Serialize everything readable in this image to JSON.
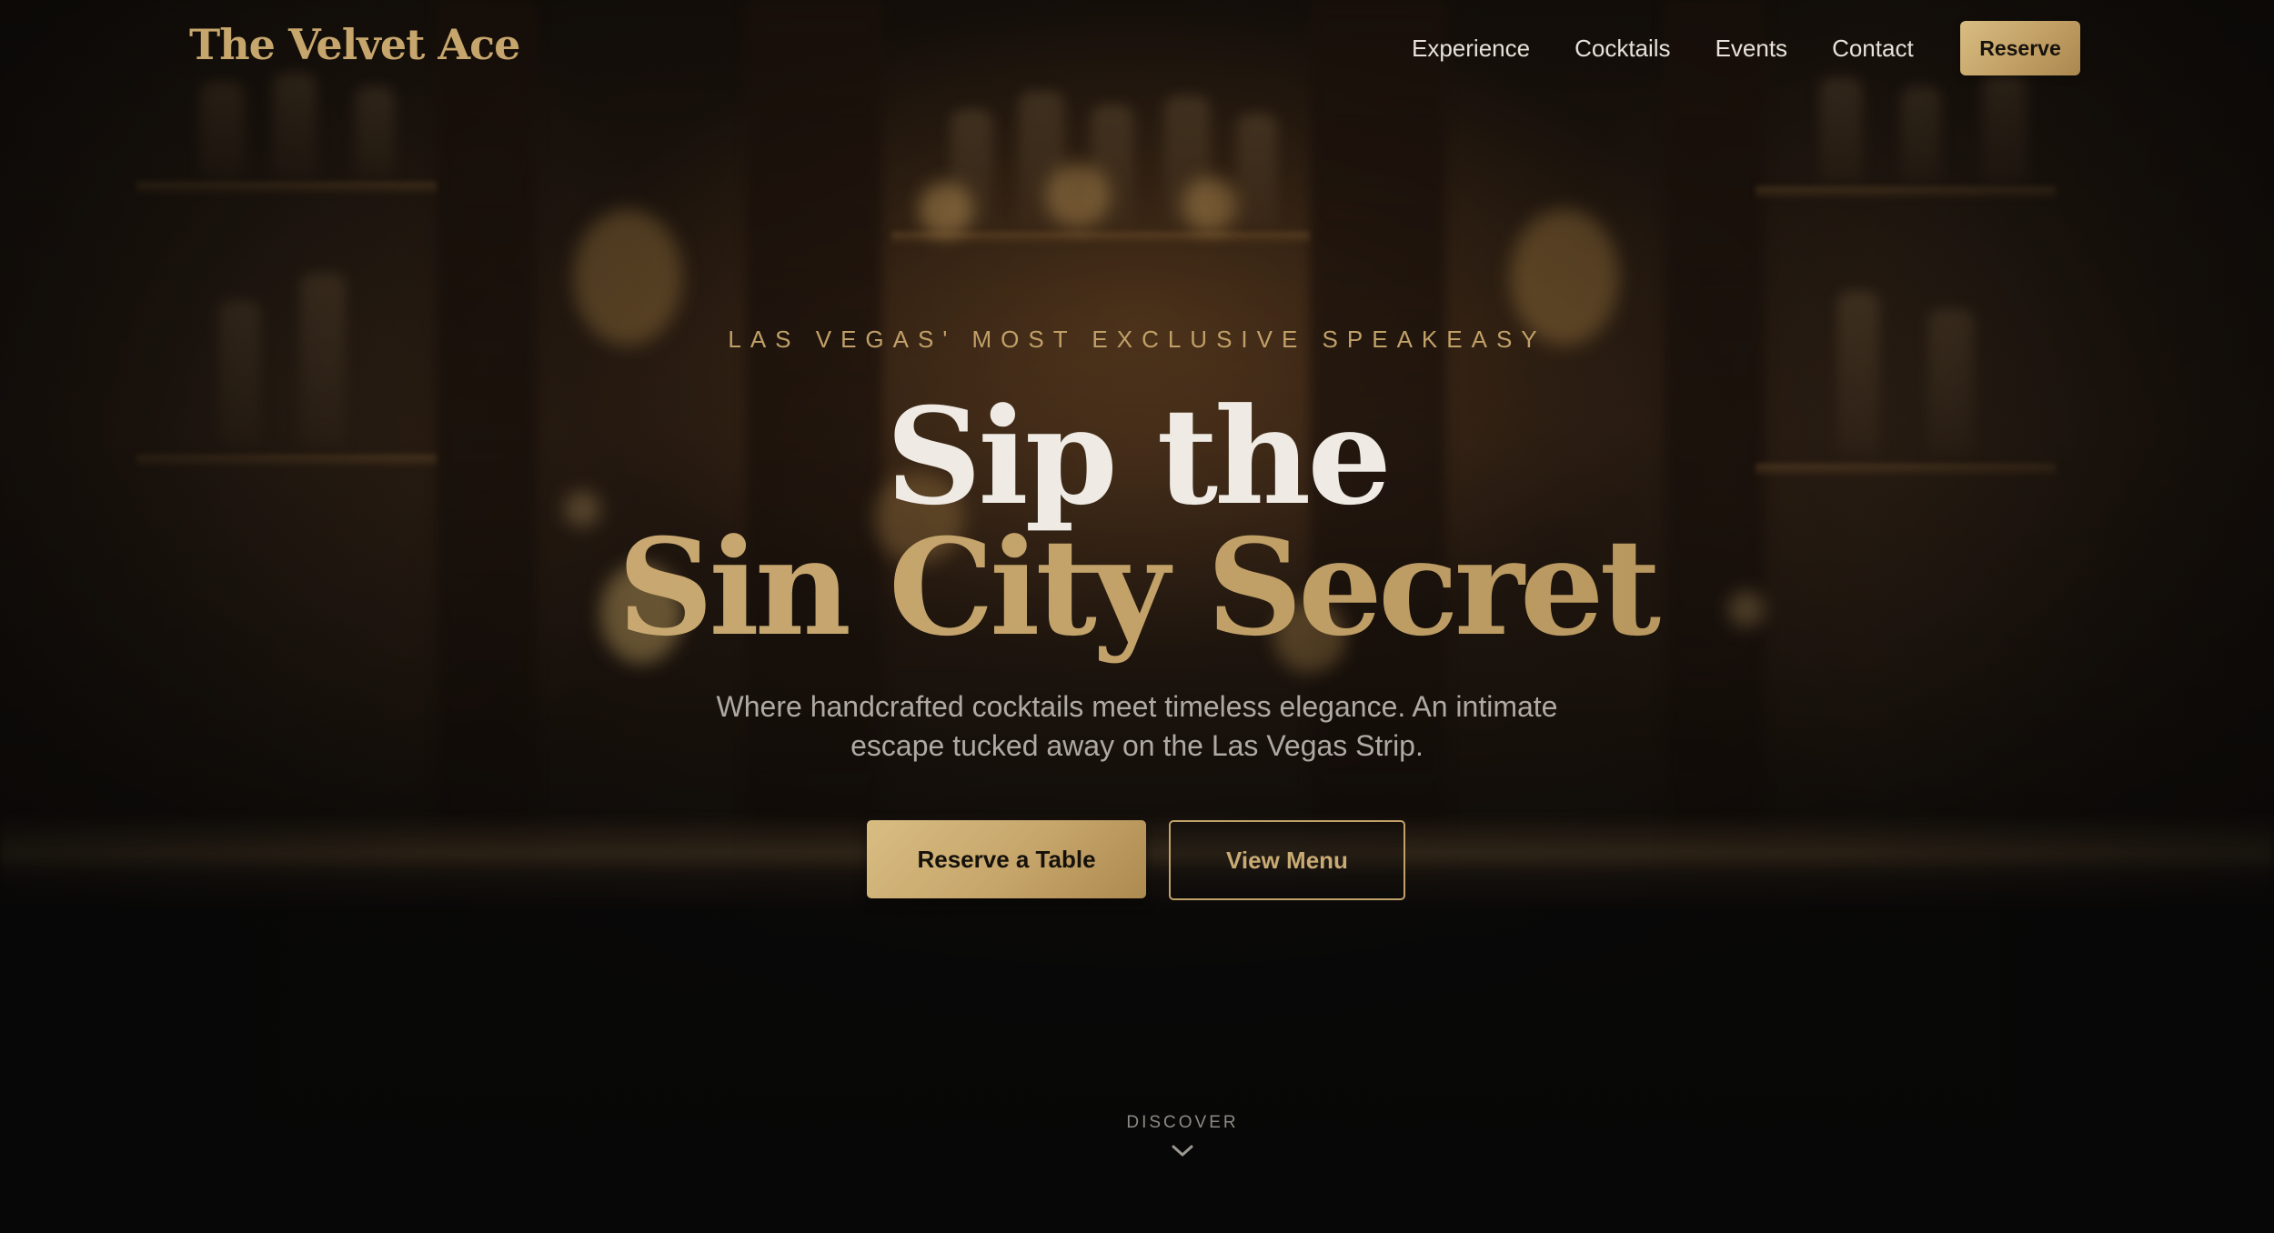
{
  "brand": {
    "name": "The Velvet Ace"
  },
  "nav": {
    "links": [
      "Experience",
      "Cocktails",
      "Events",
      "Contact"
    ],
    "reserve_label": "Reserve"
  },
  "hero": {
    "eyebrow": "LAS VEGAS' MOST EXCLUSIVE SPEAKEASY",
    "headline_line1": "Sip the",
    "headline_line2": "Sin City Secret",
    "subtitle": "Where handcrafted cocktails meet timeless elegance. An intimate escape tucked away on the Las Vegas Strip.",
    "primary_cta": "Reserve a Table",
    "secondary_cta": "View Menu",
    "scroll_label": "DISCOVER",
    "scroll_icon": "chevron-down-icon",
    "background_image": "blurred bar shelves with bottles and warm lights"
  },
  "colors": {
    "accent_gold": "#c2a269",
    "background": "#0b0b0b",
    "headline_light": "#efebe4",
    "muted_text": "#aeaaa3"
  }
}
